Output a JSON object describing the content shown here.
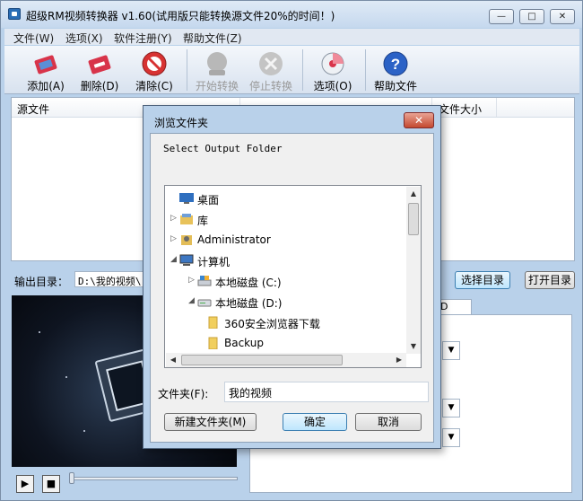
{
  "window": {
    "title": "超级RM视频转换器 v1.60(试用版只能转换源文件20%的时间！)",
    "minimize_glyph": "—",
    "maximize_glyph": "□",
    "close_glyph": "✕"
  },
  "menu": [
    "文件(W)",
    "选项(X)",
    "软件注册(Y)",
    "帮助文件(Z)"
  ],
  "toolbar": {
    "add": "添加(A)",
    "delete": "删除(D)",
    "clear": "清除(C)",
    "start": "开始转换",
    "stop": "停止转换",
    "options": "选项(O)",
    "help": "帮助文件"
  },
  "filelist": {
    "columns": [
      "源文件",
      "文件大小"
    ]
  },
  "output": {
    "label": "输出目录：",
    "value": "D:\\我的视频\\",
    "choose_button": "选择目录",
    "open_button": "打开目录"
  },
  "panel": {
    "tab_fragment": "D"
  },
  "player": {
    "play_glyph": "▶",
    "stop_glyph": "■"
  },
  "dialog": {
    "title": "浏览文件夹",
    "close_glyph": "✕",
    "prompt": "Select Output Folder",
    "tree": [
      {
        "label": "桌面",
        "expander": "",
        "icon": "desktop-icon"
      },
      {
        "label": "库",
        "expander": "▷",
        "icon": "library-icon"
      },
      {
        "label": "Administrator",
        "expander": "▷",
        "icon": "user-icon"
      },
      {
        "label": "计算机",
        "expander": "◢",
        "icon": "computer-icon"
      },
      {
        "label": "本地磁盘 (C:)",
        "expander": "▷",
        "icon": "drive-icon"
      },
      {
        "label": "本地磁盘 (D:)",
        "expander": "◢",
        "icon": "drive-icon"
      },
      {
        "label": "360安全浏览器下载",
        "expander": "",
        "icon": "folder-icon"
      },
      {
        "label": "Backup",
        "expander": "",
        "icon": "folder-icon"
      }
    ],
    "folder_label": "文件夹(F):",
    "folder_value": "我的视频",
    "new_folder_button": "新建文件夹(M)",
    "ok_button": "确定",
    "cancel_button": "取消"
  }
}
